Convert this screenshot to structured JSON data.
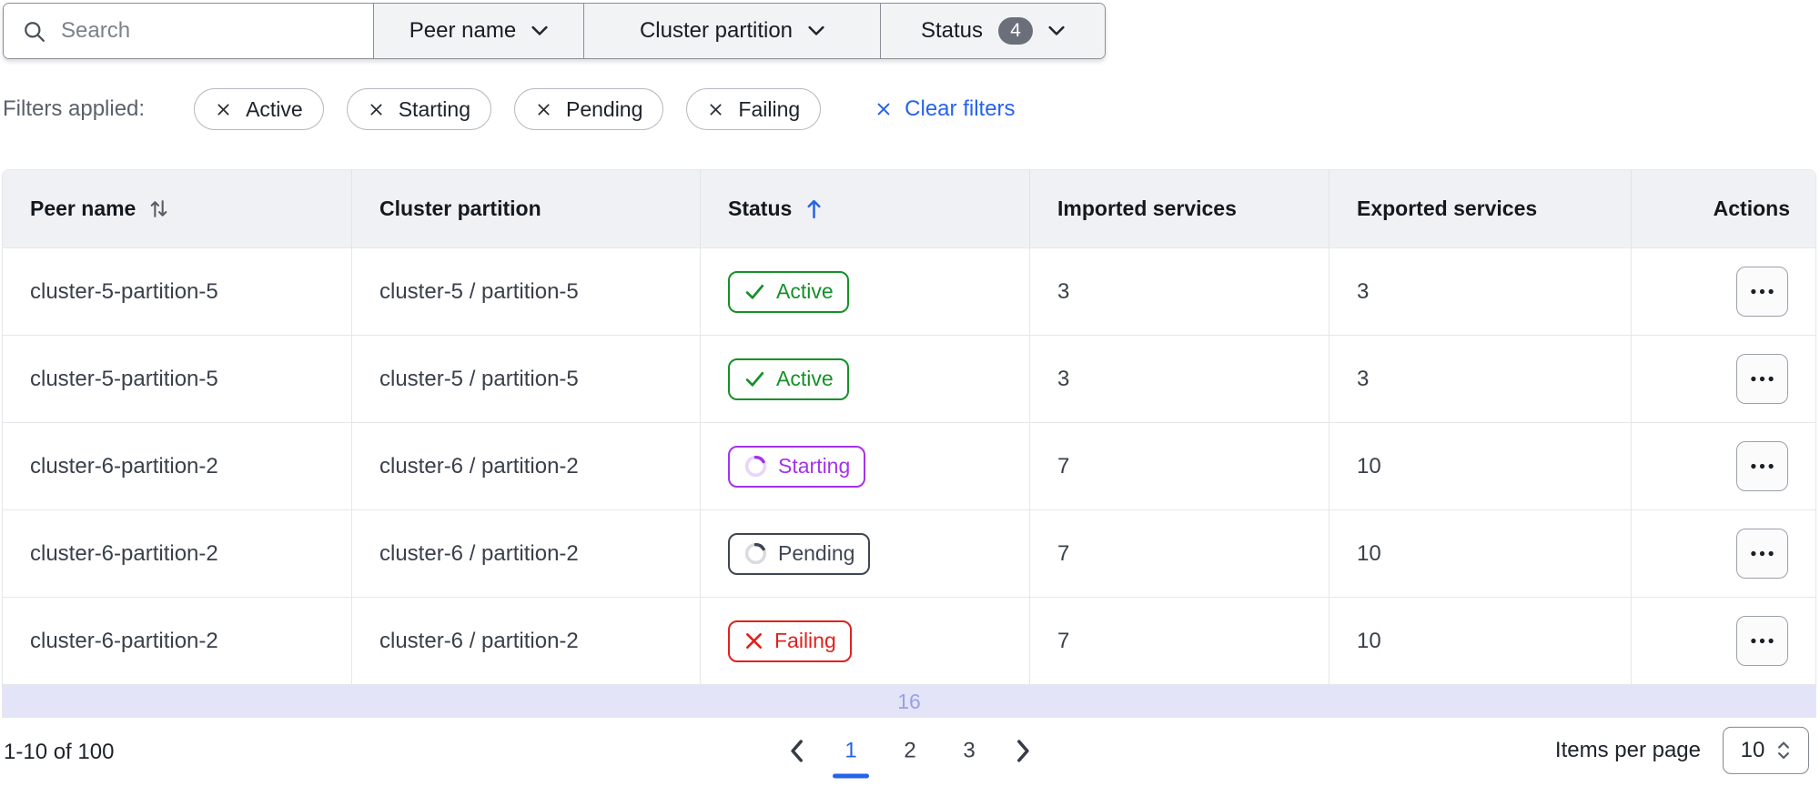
{
  "toolbar": {
    "search_placeholder": "Search",
    "dropdowns": [
      {
        "label": "Peer name"
      },
      {
        "label": "Cluster partition"
      },
      {
        "label": "Status",
        "badge": "4"
      }
    ]
  },
  "filters": {
    "label": "Filters applied:",
    "chips": [
      {
        "label": "Active"
      },
      {
        "label": "Starting"
      },
      {
        "label": "Pending"
      },
      {
        "label": "Failing"
      }
    ],
    "clear_label": "Clear filters"
  },
  "table": {
    "headers": {
      "peer_name": "Peer name",
      "cluster_partition": "Cluster partition",
      "status": "Status",
      "imported": "Imported services",
      "exported": "Exported services",
      "actions": "Actions"
    },
    "sort": {
      "column": "Status",
      "direction": "ascending"
    },
    "rows": [
      {
        "peer_name": "cluster-5-partition-5",
        "cluster_partition": "cluster-5 / partition-5",
        "status": "Active",
        "imported": "3",
        "exported": "3"
      },
      {
        "peer_name": "cluster-5-partition-5",
        "cluster_partition": "cluster-5 / partition-5",
        "status": "Active",
        "imported": "3",
        "exported": "3"
      },
      {
        "peer_name": "cluster-6-partition-2",
        "cluster_partition": "cluster-6 / partition-2",
        "status": "Starting",
        "imported": "7",
        "exported": "10"
      },
      {
        "peer_name": "cluster-6-partition-2",
        "cluster_partition": "cluster-6 / partition-2",
        "status": "Pending",
        "imported": "7",
        "exported": "10"
      },
      {
        "peer_name": "cluster-6-partition-2",
        "cluster_partition": "cluster-6 / partition-2",
        "status": "Failing",
        "imported": "7",
        "exported": "10"
      }
    ],
    "loading_indicator": "16"
  },
  "pagination": {
    "range": "1-10 of 100",
    "pages": [
      "1",
      "2",
      "3"
    ],
    "current_page": "1",
    "items_per_page_label": "Items per page",
    "items_per_page_value": "10"
  },
  "icons": {
    "search": "magnifying-glass",
    "dropdown_caret": "chevron-down",
    "chip_remove": "x-mark",
    "sort_both": "arrows-up-down",
    "sort_ascending": "arrow-up",
    "status_active": "check-mark",
    "status_starting": "spinner",
    "status_pending": "spinner",
    "status_failing": "x-mark",
    "row_actions": "ellipsis",
    "prev_page": "chevron-left",
    "next_page": "chevron-right",
    "items_per_page_stepper": "chevron-up-down"
  },
  "colors": {
    "accent_blue": "#2563eb",
    "status_active_green": "#149128",
    "status_starting_purple": "#a432ec",
    "status_pending_slate": "#3f4653",
    "status_failing_red": "#e0211c",
    "filter_count_badge_bg": "#6a6f7a",
    "loading_strip_bg": "#e3e4f7",
    "table_header_bg": "#f0f1f4"
  }
}
